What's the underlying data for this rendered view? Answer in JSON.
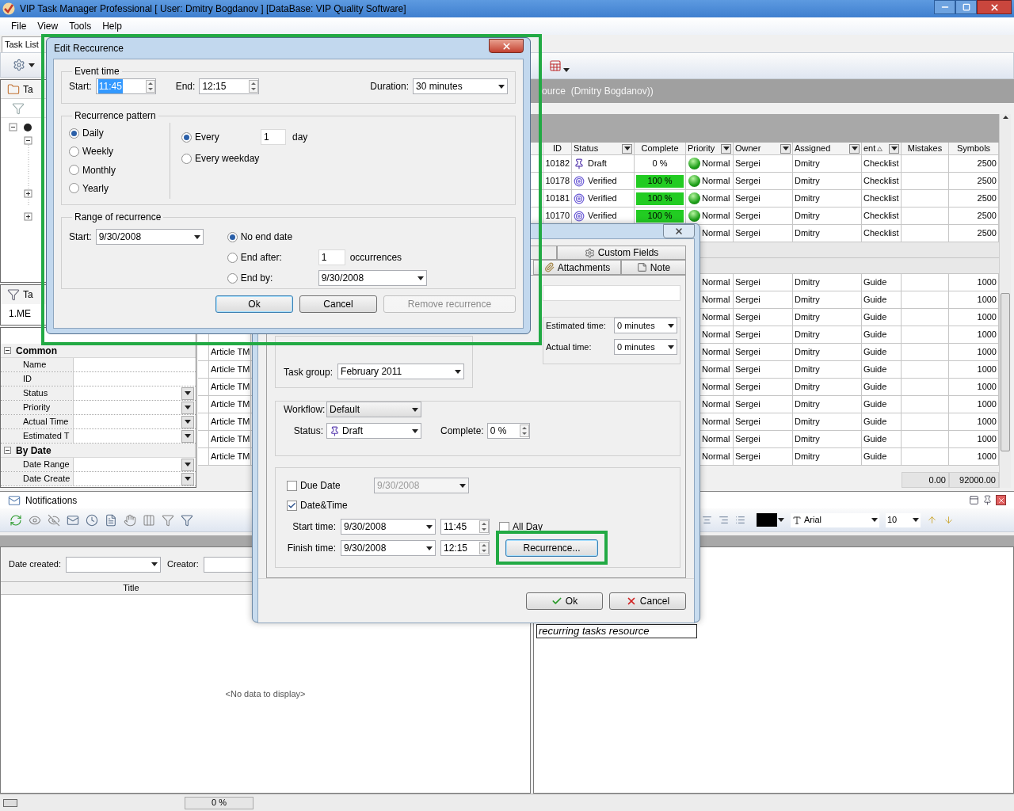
{
  "window": {
    "title": "VIP Task Manager Professional [ User: Dmitry Bogdanov ] [DataBase: VIP Quality Software]"
  },
  "menu": [
    "File",
    "View",
    "Tools",
    "Help"
  ],
  "doc_tab": {
    "label": "Task List",
    "selected": true
  },
  "left_panel": {
    "tree_title": "Ta",
    "filter_title": "Ta",
    "filter_value": "1.ME",
    "properties": [
      {
        "kind": "category",
        "label": "Common",
        "expanded": true
      },
      {
        "kind": "field",
        "label": "Name",
        "dropdown": false
      },
      {
        "kind": "field",
        "label": "ID",
        "dropdown": false
      },
      {
        "kind": "field",
        "label": "Status",
        "dropdown": true
      },
      {
        "kind": "field",
        "label": "Priority",
        "dropdown": true
      },
      {
        "kind": "field",
        "label": "Actual Time",
        "dropdown": true
      },
      {
        "kind": "field",
        "label": "Estimated T",
        "dropdown": true
      },
      {
        "kind": "category",
        "label": "By Date",
        "expanded": true
      },
      {
        "kind": "field",
        "label": "Date Range",
        "dropdown": true
      },
      {
        "kind": "field",
        "label": "Date Create",
        "dropdown": true
      }
    ]
  },
  "grid": {
    "header": "ource  (Dmitry Bogdanov))",
    "columns": [
      {
        "label": "ID",
        "filter": false,
        "sorted": false
      },
      {
        "label": "Status",
        "filter": true,
        "sorted": false
      },
      {
        "label": "Complete",
        "filter": false,
        "sorted": false
      },
      {
        "label": "Priority",
        "filter": true,
        "sorted": false
      },
      {
        "label": "Owner",
        "filter": true,
        "sorted": false
      },
      {
        "label": "Assigned",
        "filter": true,
        "sorted": false
      },
      {
        "label": "ent",
        "filter": true,
        "sorted": true
      },
      {
        "label": "Mistakes",
        "filter": false,
        "sorted": false
      },
      {
        "label": "Symbols",
        "filter": false,
        "sorted": false
      }
    ],
    "rows": [
      {
        "id": "10182",
        "status": {
          "kind": "draft",
          "label": "Draft"
        },
        "complete": "0 %",
        "level": 0,
        "priority": "Normal",
        "owner": "Sergei",
        "assigned": "Dmitry",
        "column_7": "Checklist",
        "symbols": "2500"
      },
      {
        "id": "10178",
        "status": {
          "kind": "verified",
          "label": "Verified"
        },
        "complete": "100 %",
        "level": 1,
        "priority": "Normal",
        "owner": "Sergei",
        "assigned": "Dmitry",
        "column_7": "Checklist",
        "symbols": "2500"
      },
      {
        "id": "10181",
        "status": {
          "kind": "verified",
          "label": "Verified"
        },
        "complete": "100 %",
        "level": 1,
        "priority": "Normal",
        "owner": "Sergei",
        "assigned": "Dmitry",
        "column_7": "Checklist",
        "symbols": "2500"
      },
      {
        "id": "10170",
        "status": {
          "kind": "verified",
          "label": "Verified"
        },
        "complete": "100 %",
        "level": 1,
        "priority": "Normal",
        "owner": "Sergei",
        "assigned": "Dmitry",
        "column_7": "Checklist",
        "symbols": "2500"
      },
      {
        "priority": "Normal",
        "owner": "Sergei",
        "assigned": "Dmitry",
        "column_7": "Checklist",
        "symbols": "2500"
      }
    ],
    "guide_rows": [
      {
        "priority": "Normal",
        "owner": "Sergei",
        "assigned": "Dmitry",
        "column_7": "Guide",
        "symbols": "1000"
      },
      {
        "priority": "Normal",
        "owner": "Sergei",
        "assigned": "Dmitry",
        "column_7": "Guide",
        "symbols": "1000"
      },
      {
        "priority": "Normal",
        "owner": "Sergei",
        "assigned": "Dmitry",
        "column_7": "Guide",
        "symbols": "1000"
      },
      {
        "priority": "Normal",
        "owner": "Sergei",
        "assigned": "Dmitry",
        "column_7": "Guide",
        "symbols": "1000"
      },
      {
        "title": "Article TM",
        "priority": "Normal",
        "owner": "Sergei",
        "assigned": "Dmitry",
        "column_7": "Guide",
        "symbols": "1000"
      },
      {
        "title": "Article TM",
        "priority": "Normal",
        "owner": "Sergei",
        "assigned": "Dmitry",
        "column_7": "Guide",
        "symbols": "1000"
      },
      {
        "title": "Article TM",
        "priority": "Normal",
        "owner": "Sergei",
        "assigned": "Dmitry",
        "column_7": "Guide",
        "symbols": "1000"
      },
      {
        "title": "Article TM",
        "priority": "Normal",
        "owner": "Sergei",
        "assigned": "Dmitry",
        "column_7": "Guide",
        "symbols": "1000"
      },
      {
        "title": "Article TM",
        "priority": "Normal",
        "owner": "Sergei",
        "assigned": "Dmitry",
        "column_7": "Guide",
        "symbols": "1000"
      },
      {
        "title": "Article TM",
        "priority": "Normal",
        "owner": "Sergei",
        "assigned": "Dmitry",
        "column_7": "Guide",
        "symbols": "1000"
      },
      {
        "title": "Article TM",
        "priority": "Normal",
        "owner": "Sergei",
        "assigned": "Dmitry",
        "column_7": "Guide",
        "symbols": "1000"
      }
    ],
    "totals": {
      "mistakes": "0.00",
      "symbols": "92000.00"
    }
  },
  "notifications": {
    "title": "Notifications",
    "date_created_label": "Date created:",
    "creator_label": "Creator:",
    "title_column": "Title",
    "empty": "<No data to display>"
  },
  "editor": {
    "font": "Arial",
    "font_size": "10",
    "note": "recurring tasks resource"
  },
  "status_bar": {
    "progress": "0 %",
    "level": 0
  },
  "task_dialog": {
    "tabs": [
      {
        "label": "Custom Fields",
        "selected": false
      },
      {
        "label": "Attachments",
        "selected": false
      },
      {
        "label": "Note",
        "selected": false
      }
    ],
    "estimated_label": "Estimated time:",
    "estimated": "0 minutes",
    "actual_label": "Actual time:",
    "actual": "0 minutes",
    "task_group_label": "Task group:",
    "task_group": "February 2011",
    "workflow_label": "Workflow:",
    "workflow": "Default",
    "status_label": "Status:",
    "status": "Draft",
    "complete_label": "Complete:",
    "complete": "0 %",
    "due_date": {
      "label": "Due Date",
      "checked": false,
      "value": "9/30/2008",
      "disabled": true
    },
    "date_time": {
      "label": "Date&Time",
      "checked": true
    },
    "start_label": "Start time:",
    "start_date": "9/30/2008",
    "start_time": "11:45",
    "finish_label": "Finish time:",
    "finish_date": "9/30/2008",
    "finish_time": "12:15",
    "all_day": {
      "label": "All Day",
      "checked": false
    },
    "recurrence_button": "Recurrence...",
    "ok": "Ok",
    "cancel": "Cancel"
  },
  "recurrence_dialog": {
    "title": "Edit Reccurence",
    "event_time": {
      "legend": "Event time",
      "start_label": "Start:",
      "start": "11:45",
      "start_highlighted": true,
      "end_label": "End:",
      "end": "12:15",
      "duration_label": "Duration:",
      "duration": "30 minutes"
    },
    "pattern": {
      "legend": "Recurrence pattern",
      "types": [
        {
          "label": "Daily",
          "selected": true
        },
        {
          "label": "Weekly",
          "selected": false
        },
        {
          "label": "Monthly",
          "selected": false
        },
        {
          "label": "Yearly",
          "selected": false
        }
      ],
      "options": [
        {
          "label": "Every",
          "selected": true,
          "value": "1",
          "unit": "day"
        },
        {
          "label": "Every weekday",
          "selected": false
        }
      ]
    },
    "range": {
      "legend": "Range of recurrence",
      "start_label": "Start:",
      "start": "9/30/2008",
      "ends": [
        {
          "kind": "none",
          "label": "No end date",
          "selected": true
        },
        {
          "kind": "after",
          "label": "End after:",
          "selected": false,
          "value": "1",
          "unit": "occurrences"
        },
        {
          "kind": "by",
          "label": "End by:",
          "selected": false,
          "value": "9/30/2008"
        }
      ]
    },
    "buttons": [
      {
        "label": "Ok",
        "default": true,
        "disabled": false
      },
      {
        "label": "Cancel",
        "default": false,
        "disabled": false
      },
      {
        "label": "Remove recurrence",
        "default": false,
        "disabled": true
      }
    ]
  }
}
